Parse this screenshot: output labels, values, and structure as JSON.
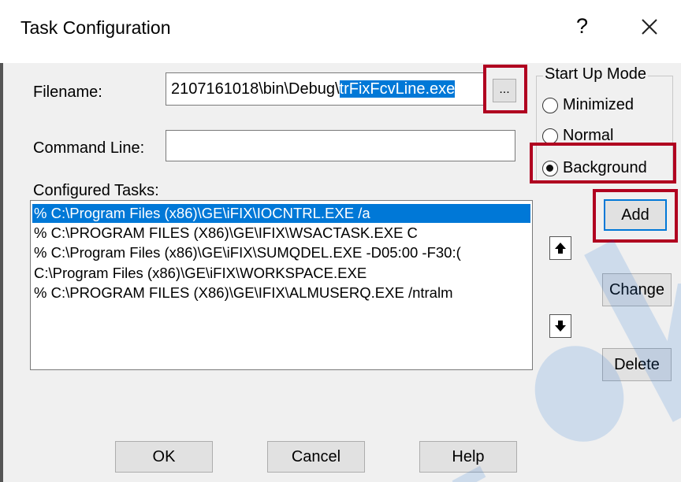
{
  "window": {
    "title": "Task Configuration",
    "help_glyph": "?"
  },
  "form": {
    "filename_label": "Filename:",
    "filename_prefix": "2107161018\\bin\\Debug\\",
    "filename_selected": "trFixFcvLine.exe",
    "browse_label": "...",
    "command_line_label": "Command Line:",
    "command_line_value": ""
  },
  "start_up_mode": {
    "label": "Start Up Mode",
    "options": [
      "Minimized",
      "Normal",
      "Background"
    ],
    "selected": "Background"
  },
  "configured_tasks": {
    "label": "Configured Tasks:",
    "items": [
      "% C:\\Program Files (x86)\\GE\\iFIX\\IOCNTRL.EXE  /a",
      "% C:\\PROGRAM FILES (X86)\\GE\\IFIX\\WSACTASK.EXE  C",
      "% C:\\Program Files (x86)\\GE\\iFIX\\SUMQDEL.EXE  -D05:00 -F30:(",
      "  C:\\Program Files (x86)\\GE\\iFIX\\WORKSPACE.EXE",
      "% C:\\PROGRAM FILES (X86)\\GE\\IFIX\\ALMUSERQ.EXE  /ntralm"
    ],
    "selected_index": 0
  },
  "buttons": {
    "add": "Add",
    "change": "Change",
    "delete": "Delete",
    "ok": "OK",
    "cancel": "Cancel",
    "help": "Help"
  },
  "colors": {
    "highlight": "#b00020",
    "selection": "#0078d7",
    "watermark": "#1e73d6"
  }
}
